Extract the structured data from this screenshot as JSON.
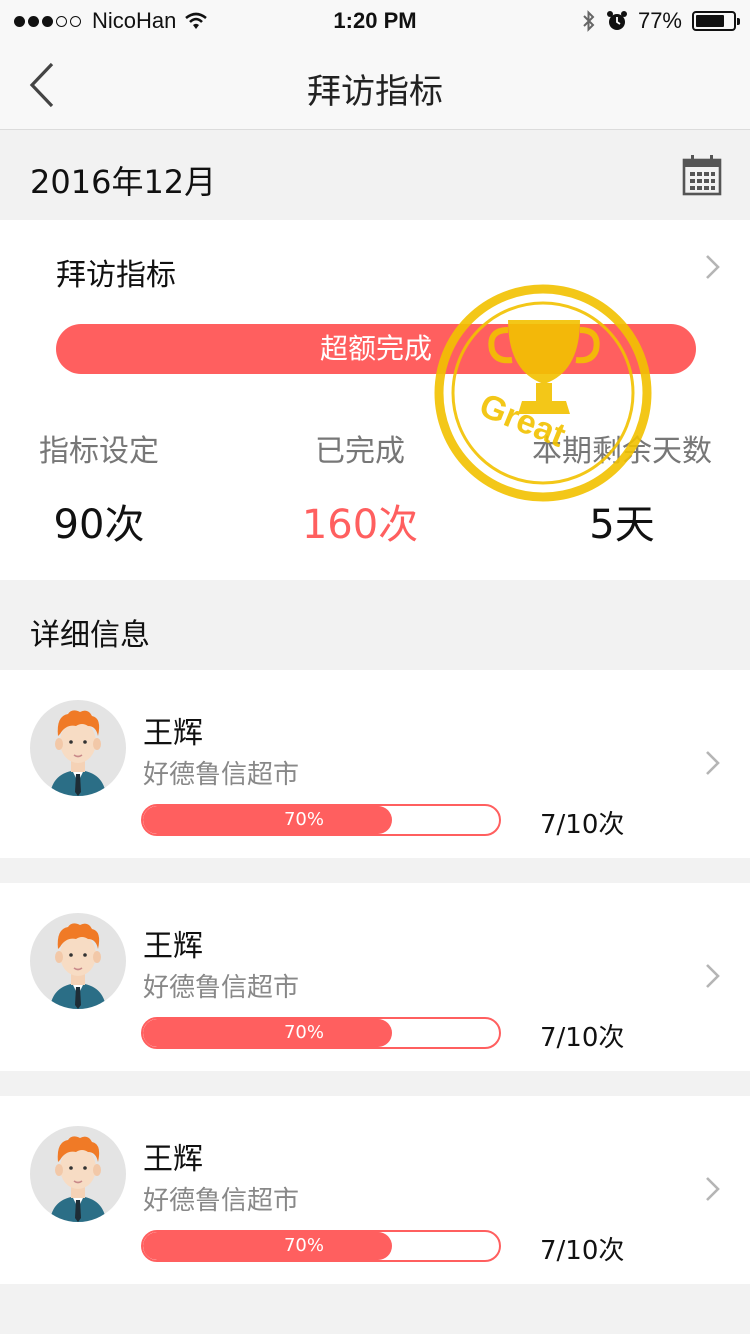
{
  "status_bar": {
    "carrier": "NicoHan",
    "time": "1:20 PM",
    "battery_pct": "77%",
    "battery_level": 0.77,
    "signal_dots": [
      true,
      true,
      true,
      false,
      false
    ]
  },
  "nav": {
    "title": "拜访指标"
  },
  "month": {
    "label": "2016年12月"
  },
  "summary": {
    "title": "拜访指标",
    "status_label": "超额完成",
    "stats": [
      {
        "label": "指标设定",
        "value": "90次",
        "accent": false
      },
      {
        "label": "已完成",
        "value": "160次",
        "accent": true
      },
      {
        "label": "本期剩余天数",
        "value": "5天",
        "accent": false
      }
    ],
    "stamp_text": "Great"
  },
  "detail": {
    "header": "详细信息",
    "rows": [
      {
        "name": "王辉",
        "store": "好德鲁信超市",
        "progress_label": "70%",
        "progress": 0.7,
        "count": "7/10次"
      },
      {
        "name": "王辉",
        "store": "好德鲁信超市",
        "progress_label": "70%",
        "progress": 0.7,
        "count": "7/10次"
      },
      {
        "name": "王辉",
        "store": "好德鲁信超市",
        "progress_label": "70%",
        "progress": 0.7,
        "count": "7/10次"
      }
    ]
  },
  "colors": {
    "accent": "#ff5f5f",
    "stamp": "#f2c200",
    "hair": "#f07a26",
    "shirt": "#2b6e86"
  }
}
